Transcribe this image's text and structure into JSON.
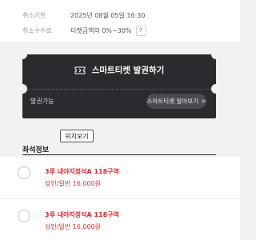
{
  "info": {
    "cancel_deadline_label": "취소기한",
    "cancel_deadline_value": "2025년 08월 05일 16:30",
    "cancel_fee_label": "취소수수료",
    "cancel_fee_value": "티켓금액의 0%~30%",
    "help_label": "?"
  },
  "smart_ticket": {
    "title": "스마트티켓 발권하기",
    "status_label": "발권가능",
    "learn_more_label": "스마트티켓 알아보기",
    "learn_more_arrow": ">"
  },
  "tooltip": {
    "label": "위치보기"
  },
  "seats": {
    "section_title": "좌석정보",
    "items": [
      {
        "line1": "3루 내야지정석A 118구역",
        "line2": "성인/일반 16,000원"
      },
      {
        "line1": "3루 내야지정석A 118구역",
        "line2": "성인/일반 16,000원"
      }
    ]
  },
  "colors": {
    "accent_red": "#e8262d",
    "ticket_bg": "#2b2b2f"
  }
}
